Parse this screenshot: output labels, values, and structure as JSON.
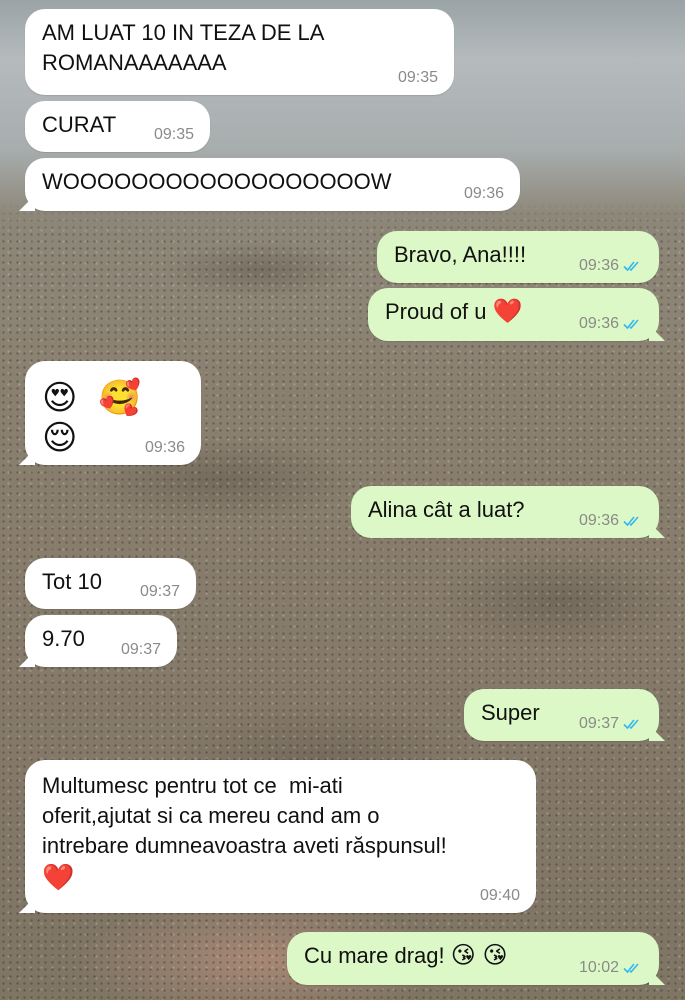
{
  "messages": [
    {
      "text": "AM LUAT 10 IN TEZA DE LA\nROMANAAAAAAA",
      "time": "09:35",
      "dir": "in"
    },
    {
      "text": "CURAT",
      "time": "09:35",
      "dir": "in"
    },
    {
      "text": "WOOOOOOOOOOOOOOOOOOW",
      "time": "09:36",
      "dir": "in"
    },
    {
      "text": "Bravo, Ana!!!!",
      "time": "09:36",
      "dir": "out",
      "status": "read"
    },
    {
      "text": "Proud of u",
      "emoji": "❤️",
      "time": "09:36",
      "dir": "out",
      "status": "read"
    },
    {
      "text": "😍 🥰 😌",
      "time": "09:36",
      "dir": "in"
    },
    {
      "text": "Alina cât a luat?",
      "time": "09:36",
      "dir": "out",
      "status": "read"
    },
    {
      "text": "Tot 10",
      "time": "09:37",
      "dir": "in"
    },
    {
      "text": "9.70",
      "time": "09:37",
      "dir": "in"
    },
    {
      "text": "Super",
      "time": "09:37",
      "dir": "out",
      "status": "read"
    },
    {
      "text": "Multumesc pentru tot ce  mi-ati\noferit,ajutat si ca mereu cand am o\nintrebare dumneavoastra aveti răspunsul!",
      "emoji": "❤️",
      "time": "09:40",
      "dir": "in"
    },
    {
      "text": "Cu mare drag!",
      "emoji": "😘 😘",
      "time": "10:02",
      "dir": "out",
      "status": "read"
    }
  ],
  "colors": {
    "incoming_bubble": "#ffffff",
    "outgoing_bubble": "#dcf8c6",
    "read_ticks": "#34b7f1",
    "timestamp": "#8a8a8a"
  },
  "icons": {
    "read_status": "double-check-icon",
    "heart": "heart-icon"
  }
}
